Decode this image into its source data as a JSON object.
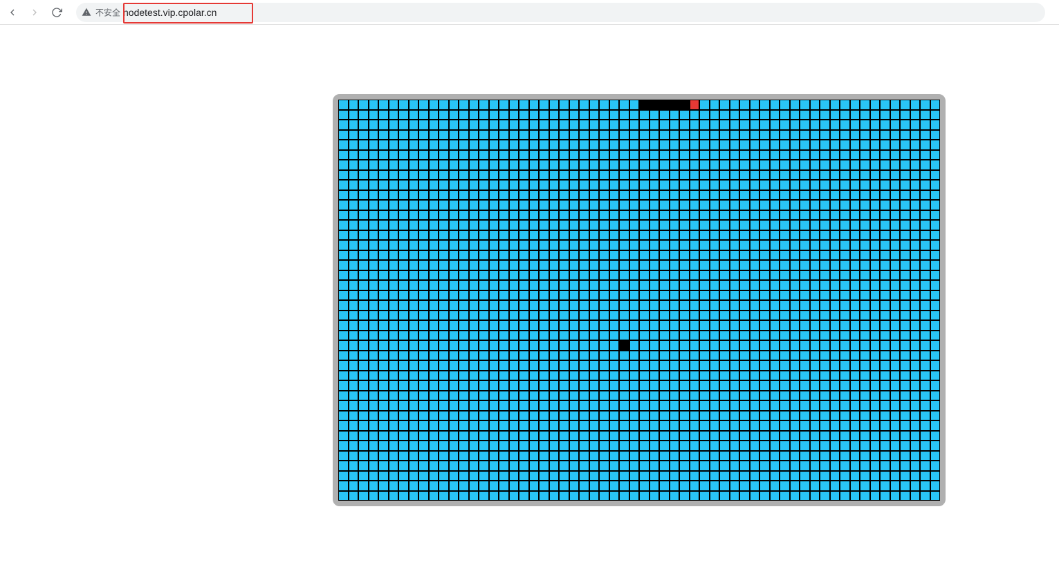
{
  "browser": {
    "security_label": "不安全",
    "url": "nodetest.vip.cpolar.cn"
  },
  "game": {
    "grid": {
      "cols": 60,
      "rows": 40,
      "cell_size": 14.5
    },
    "colors": {
      "board_bg": "#29c5f6",
      "grid_line": "#000000",
      "snake": "#000000",
      "food": "#e53935",
      "border": "#b0b0b0"
    },
    "snake_segments": [
      {
        "row": 0,
        "col": 30
      },
      {
        "row": 0,
        "col": 31
      },
      {
        "row": 0,
        "col": 32
      },
      {
        "row": 0,
        "col": 33
      },
      {
        "row": 0,
        "col": 34
      }
    ],
    "snake_head": {
      "row": 0,
      "col": 35,
      "color": "red"
    },
    "food": {
      "row": 24,
      "col": 28
    }
  }
}
